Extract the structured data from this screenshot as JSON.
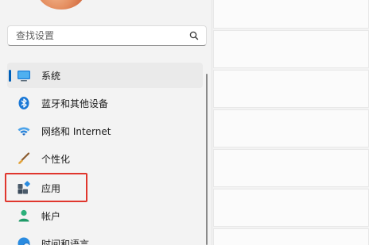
{
  "search": {
    "placeholder": "查找设置"
  },
  "nav": {
    "items": [
      {
        "id": "system",
        "label": "系统",
        "icon": "monitor-icon",
        "selected": true
      },
      {
        "id": "bluetooth",
        "label": "蓝牙和其他设备",
        "icon": "bluetooth-icon"
      },
      {
        "id": "network",
        "label": "网络和 Internet",
        "icon": "wifi-icon"
      },
      {
        "id": "personalization",
        "label": "个性化",
        "icon": "brush-icon"
      },
      {
        "id": "apps",
        "label": "应用",
        "icon": "apps-icon",
        "highlighted": true
      },
      {
        "id": "accounts",
        "label": "帐户",
        "icon": "account-icon"
      },
      {
        "id": "time-language",
        "label": "时间和语言",
        "icon": "globe-clock-icon"
      }
    ]
  },
  "colors": {
    "accent": "#005fb8",
    "highlight_border": "#e0362d",
    "background": "#f3f3f3",
    "card": "#fbfbfb"
  }
}
